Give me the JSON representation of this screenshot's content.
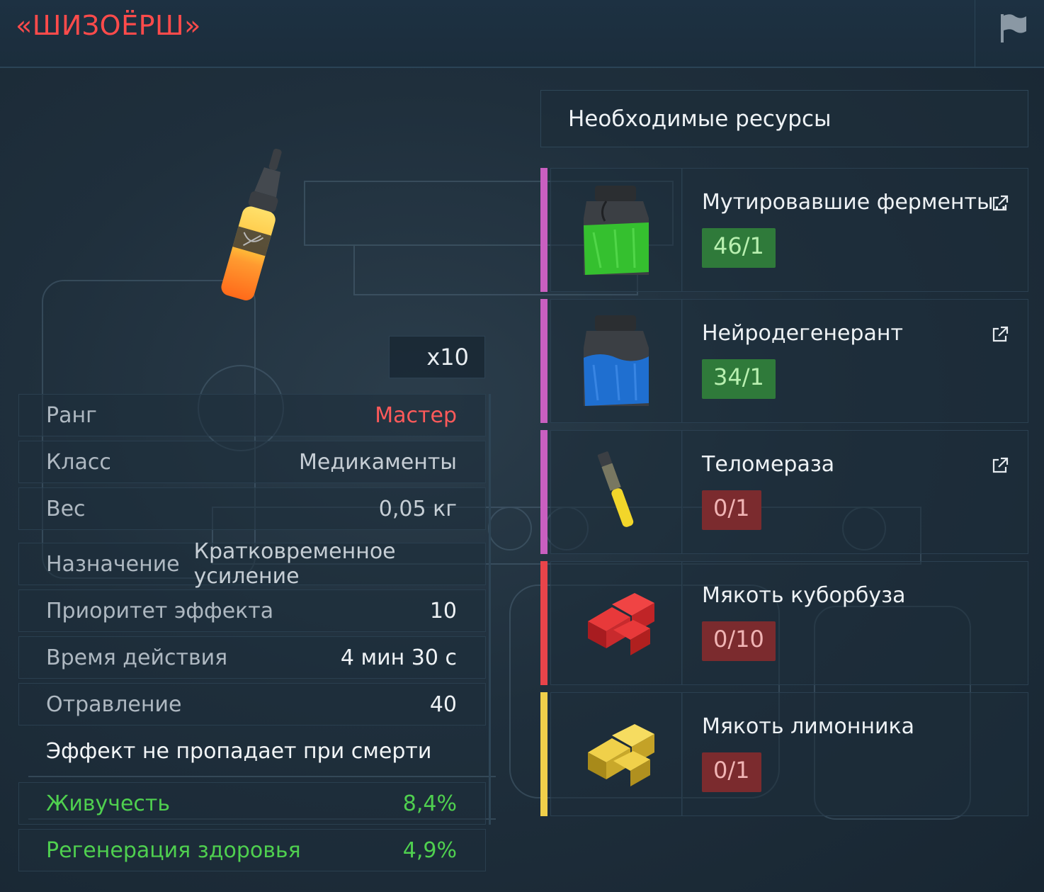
{
  "header": {
    "title": "«ШИЗОЁРШ»",
    "flag_icon": "flag-icon"
  },
  "item": {
    "image_icon": "ampoule-icon",
    "count": "x10"
  },
  "stats": {
    "rank": {
      "label": "Ранг",
      "value": "Мастер"
    },
    "class": {
      "label": "Класс",
      "value": "Медикаменты"
    },
    "weight": {
      "label": "Вес",
      "value": "0,05 кг"
    },
    "purpose": {
      "label": "Назначение",
      "value": "Кратковременное усиление"
    },
    "priority": {
      "label": "Приоритет эффекта",
      "value": "10"
    },
    "duration": {
      "label": "Время действия",
      "value": "4 мин 30 с"
    },
    "poison": {
      "label": "Отравление",
      "value": "40"
    },
    "note": "Эффект не пропадает при смерти",
    "vitality": {
      "label": "Живучесть",
      "value": "8,4%"
    },
    "regen": {
      "label": "Регенерация здоровья",
      "value": "4,9%"
    }
  },
  "resources": {
    "header": "Необходимые ресурсы",
    "items": [
      {
        "name": "Мутировавшие ферменты..",
        "amount": "46/1",
        "icon": "green-jar-icon",
        "rarity_color": "#c95fc0",
        "has_link": true
      },
      {
        "name": "Нейродегенерант",
        "amount": "34/1",
        "icon": "blue-jar-icon",
        "rarity_color": "#c95fc0",
        "has_link": true
      },
      {
        "name": "Теломераза",
        "amount": "0/1",
        "icon": "test-tube-icon",
        "rarity_color": "#c95fc0",
        "has_link": true
      },
      {
        "name": "Мякоть куборбуза",
        "amount": "0/10",
        "icon": "red-cubes-icon",
        "rarity_color": "#e8444a",
        "has_link": false
      },
      {
        "name": "Мякоть лимонника",
        "amount": "0/1",
        "icon": "yellow-cubes-icon",
        "rarity_color": "#f0cf4a",
        "has_link": false
      }
    ]
  }
}
